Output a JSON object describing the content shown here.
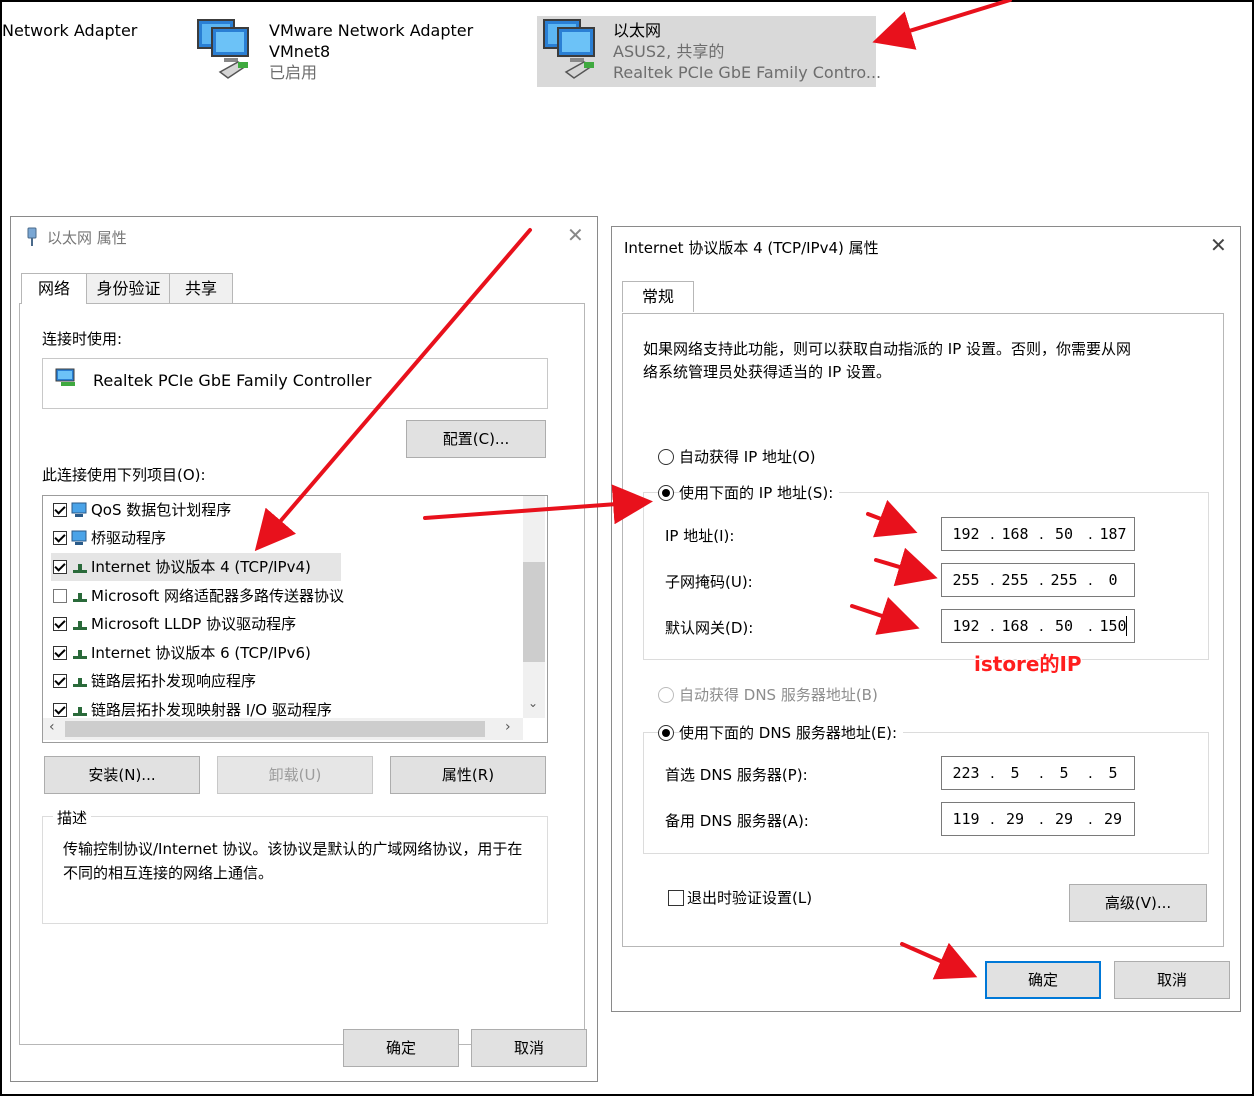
{
  "adapters": [
    {
      "name": "Network Adapter"
    },
    {
      "name": "VMware Network Adapter",
      "line2": "VMnet8",
      "status": "已启用"
    },
    {
      "name": "以太网",
      "line2": "ASUS2, 共享的",
      "status": "Realtek PCIe GbE Family Contro..."
    }
  ],
  "props_dialog": {
    "title": "以太网 属性",
    "tabs": [
      "网络",
      "身份验证",
      "共享"
    ],
    "connect_using_label": "连接时使用:",
    "adapter_name": "Realtek PCIe GbE Family Controller",
    "configure_button": "配置(C)...",
    "items_label": "此连接使用下列项目(O):",
    "items": [
      {
        "label": "QoS 数据包计划程序",
        "checked": true
      },
      {
        "label": "桥驱动程序",
        "checked": true
      },
      {
        "label": "Internet 协议版本 4 (TCP/IPv4)",
        "checked": true
      },
      {
        "label": "Microsoft 网络适配器多路传送器协议",
        "checked": false
      },
      {
        "label": "Microsoft LLDP 协议驱动程序",
        "checked": true
      },
      {
        "label": "Internet 协议版本 6 (TCP/IPv6)",
        "checked": true
      },
      {
        "label": "链路层拓扑发现响应程序",
        "checked": true
      },
      {
        "label": "链路层拓扑发现映射器 I/O 驱动程序",
        "checked": true
      }
    ],
    "install_button": "安装(N)...",
    "uninstall_button": "卸载(U)",
    "properties_button": "属性(R)",
    "description_label": "描述",
    "description_text": "传输控制协议/Internet 协议。该协议是默认的广域网络协议，用于在不同的相互连接的网络上通信。",
    "ok_button": "确定",
    "cancel_button": "取消"
  },
  "ipv4_dialog": {
    "title": "Internet 协议版本 4 (TCP/IPv4) 属性",
    "tab": "常规",
    "intro_line1": "如果网络支持此功能，则可以获取自动指派的 IP 设置。否则，你需要从网",
    "intro_line2": "络系统管理员处获得适当的 IP 设置。",
    "auto_ip_label": "自动获得 IP 地址(O)",
    "manual_ip_label": "使用下面的 IP 地址(S):",
    "ip_label": "IP 地址(I):",
    "ip": [
      "192",
      "168",
      "50",
      "187"
    ],
    "mask_label": "子网掩码(U):",
    "mask": [
      "255",
      "255",
      "255",
      "0"
    ],
    "gateway_label": "默认网关(D):",
    "gateway": [
      "192",
      "168",
      "50",
      "150"
    ],
    "annotation": "istore的IP",
    "auto_dns_label": "自动获得 DNS 服务器地址(B)",
    "manual_dns_label": "使用下面的 DNS 服务器地址(E):",
    "dns1_label": "首选 DNS 服务器(P):",
    "dns1": [
      "223",
      "5",
      "5",
      "5"
    ],
    "dns2_label": "备用 DNS 服务器(A):",
    "dns2": [
      "119",
      "29",
      "29",
      "29"
    ],
    "validate_label": "退出时验证设置(L)",
    "validate_checked": false,
    "advanced_button": "高级(V)...",
    "ok_button": "确定",
    "cancel_button": "取消",
    "selected_ip_mode": "manual",
    "selected_dns_mode": "manual"
  },
  "colors": {
    "arrow": "#e8111c",
    "annotation": "#ff1e1e",
    "selection": "#d9d9d9",
    "focus": "#0078d7"
  }
}
